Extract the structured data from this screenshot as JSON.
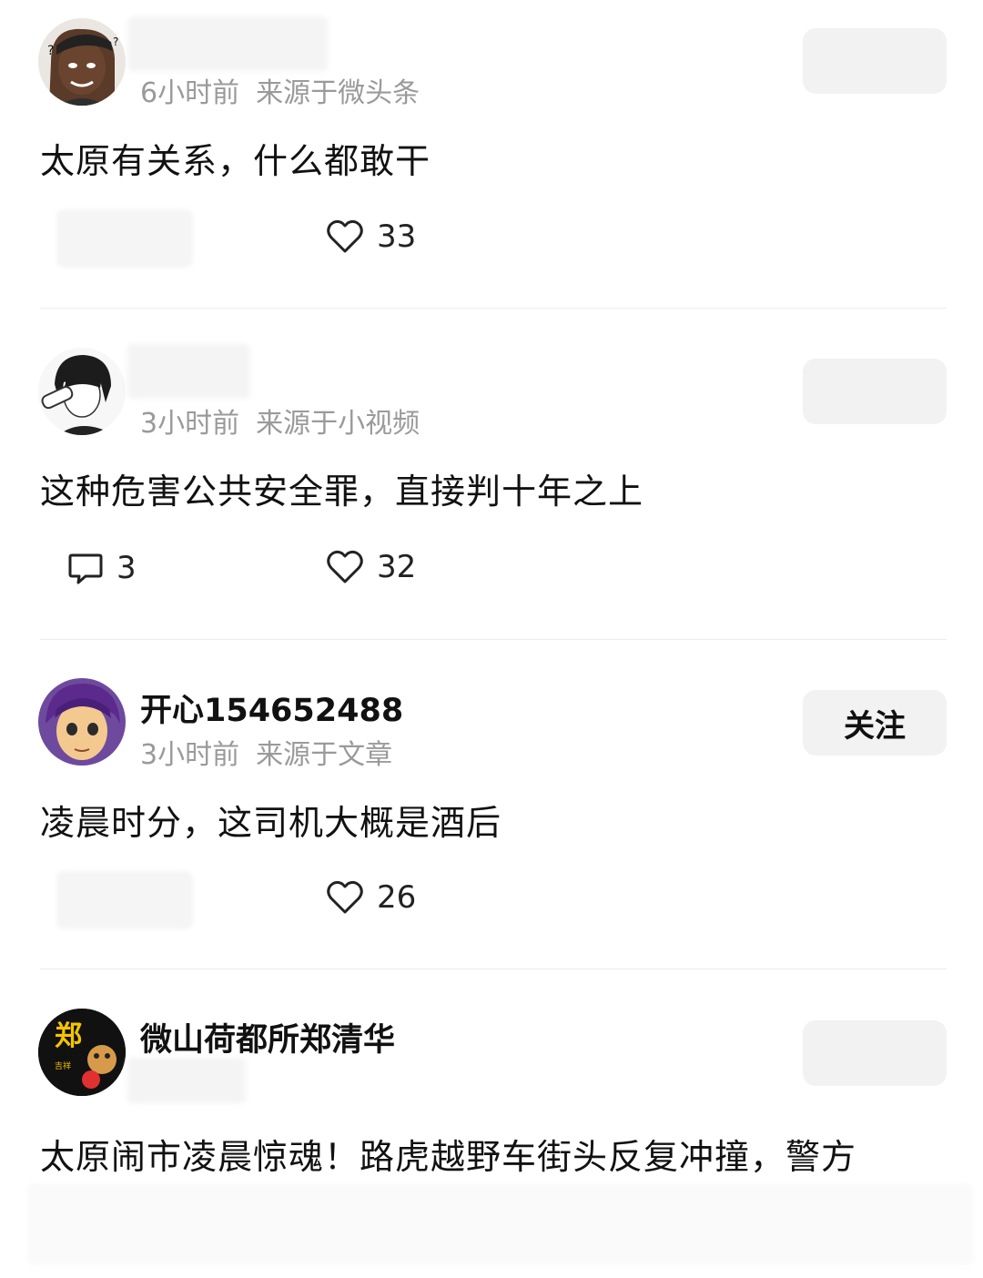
{
  "comments": [
    {
      "username": "",
      "time": "6小时前",
      "source": "来源于微头条",
      "text": "太原有关系，什么都敢干",
      "likes": "33",
      "replies": "",
      "follow_label": ""
    },
    {
      "username": "",
      "time": "3小时前",
      "source": "来源于小视频",
      "text": "这种危害公共安全罪，直接判十年之上",
      "likes": "32",
      "replies": "3",
      "follow_label": ""
    },
    {
      "username": "开心154652488",
      "time": "3小时前",
      "source": "来源于文章",
      "text": "凌晨时分，这司机大概是酒后",
      "likes": "26",
      "replies": "",
      "follow_label": "关注"
    },
    {
      "username": "微山荷都所郑清华",
      "time": "",
      "source": "",
      "text": "太原闹市凌晨惊魂！路虎越野车街头反复冲撞，警方",
      "likes": "",
      "replies": "",
      "follow_label": "",
      "avatar_text": "郑"
    }
  ],
  "icons": {
    "like": "heart-icon",
    "reply": "comment-bubble-icon"
  }
}
